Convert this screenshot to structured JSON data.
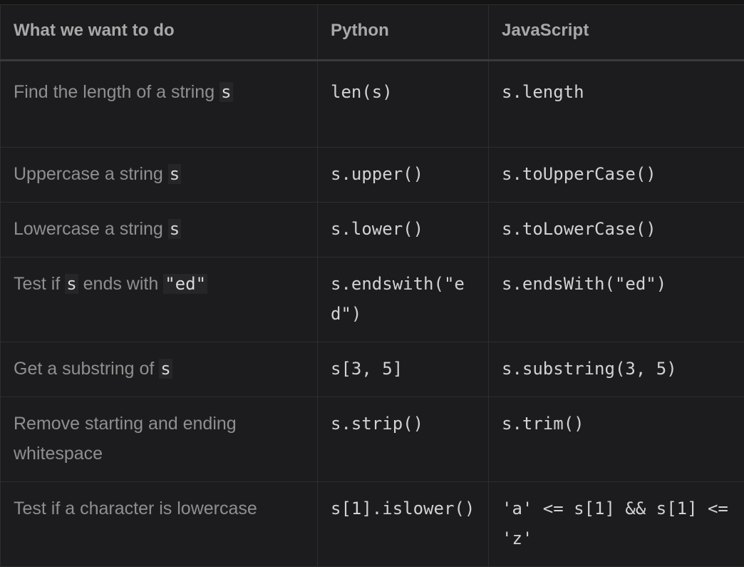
{
  "table": {
    "headers": [
      "What we want to do",
      "Python",
      "JavaScript"
    ],
    "rows": [
      {
        "desc_pre": "Find the length of a string ",
        "desc_code": "s",
        "desc_post": "",
        "desc_code2": "",
        "python": "len(s)",
        "javascript": "s.length"
      },
      {
        "desc_pre": "Uppercase a string ",
        "desc_code": "s",
        "desc_post": "",
        "desc_code2": "",
        "python": "s.upper()",
        "javascript": "s.toUpperCase()"
      },
      {
        "desc_pre": "Lowercase a string ",
        "desc_code": "s",
        "desc_post": "",
        "desc_code2": "",
        "python": "s.lower()",
        "javascript": "s.toLowerCase()"
      },
      {
        "desc_pre": "Test if ",
        "desc_code": "s",
        "desc_post": " ends with ",
        "desc_code2": "\"ed\"",
        "python": "s.endswith(\"ed\")",
        "javascript": "s.endsWith(\"ed\")"
      },
      {
        "desc_pre": "Get a substring of ",
        "desc_code": "s",
        "desc_post": "",
        "desc_code2": "",
        "python": "s[3, 5]",
        "javascript": "s.substring(3, 5)"
      },
      {
        "desc_pre": "Remove starting and ending whitespace",
        "desc_code": "",
        "desc_post": "",
        "desc_code2": "",
        "python": "s.strip()",
        "javascript": "s.trim()"
      },
      {
        "desc_pre": "Test if a character is lowercase",
        "desc_code": "",
        "desc_post": "",
        "desc_code2": "",
        "python": "s[1].islower()",
        "javascript": "'a' <= s[1] && s[1] <= 'z'"
      }
    ]
  }
}
